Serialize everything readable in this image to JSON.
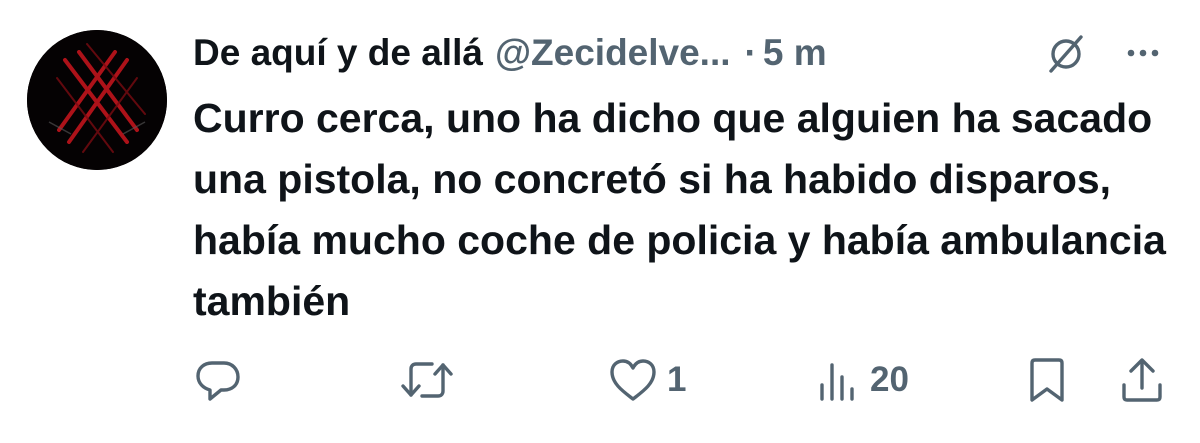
{
  "tweet": {
    "author": {
      "display_name": "De aquí y de allá",
      "handle": "@Zecidelve...",
      "avatar_icon": "dark-red-crossed-lines-avatar"
    },
    "separator": "·",
    "timestamp": "5 m",
    "text": "Curro cerca, uno ha dicho que alguien ha sacado una pistola, no concretó si ha habido disparos, había mucho coche de policia y había ambulancia también",
    "header_icons": [
      "grok-icon",
      "more-icon"
    ],
    "actions": {
      "reply": {
        "icon": "reply-icon",
        "count": ""
      },
      "retweet": {
        "icon": "retweet-icon",
        "count": ""
      },
      "like": {
        "icon": "heart-icon",
        "count": "1"
      },
      "views": {
        "icon": "views-icon",
        "count": "20"
      },
      "bookmark": {
        "icon": "bookmark-icon",
        "count": ""
      },
      "share": {
        "icon": "share-icon",
        "count": ""
      }
    }
  },
  "colors": {
    "text": "#0f1419",
    "secondary": "#536471",
    "background": "#ffffff",
    "avatar_bg": "#050203",
    "avatar_accent": "#c0141c"
  }
}
